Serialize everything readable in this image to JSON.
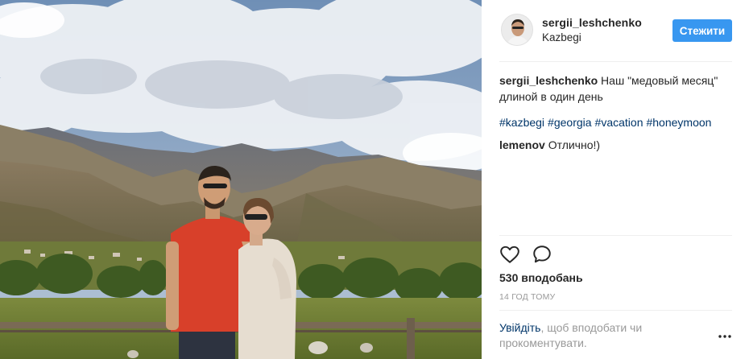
{
  "post": {
    "photo": {
      "description_icon": "landscape-photo"
    },
    "header": {
      "username": "sergii_leshchenko",
      "location": "Kazbegi",
      "follow_label": "Стежити"
    },
    "caption": {
      "author": "sergii_leshchenko",
      "text": " Наш \"медовый месяц\" длиной в один день"
    },
    "hashtags": [
      "#kazbegi",
      "#georgia",
      "#vacation",
      "#honeymoon"
    ],
    "comments": [
      {
        "author": "lemenov",
        "text": " Отлично!)"
      }
    ],
    "likes": "530 вподобань",
    "time": "14 ГОД ТОМУ",
    "prompt": {
      "link": "Увійдіть",
      "text": ", щоб вподобати чи прокоментувати."
    }
  },
  "colors": {
    "accent": "#3897f0",
    "link": "#003569",
    "muted": "#999999",
    "text": "#262626"
  },
  "icons": {
    "like": "heart-icon",
    "comment": "comment-bubble-icon",
    "more": "more-options-icon"
  }
}
